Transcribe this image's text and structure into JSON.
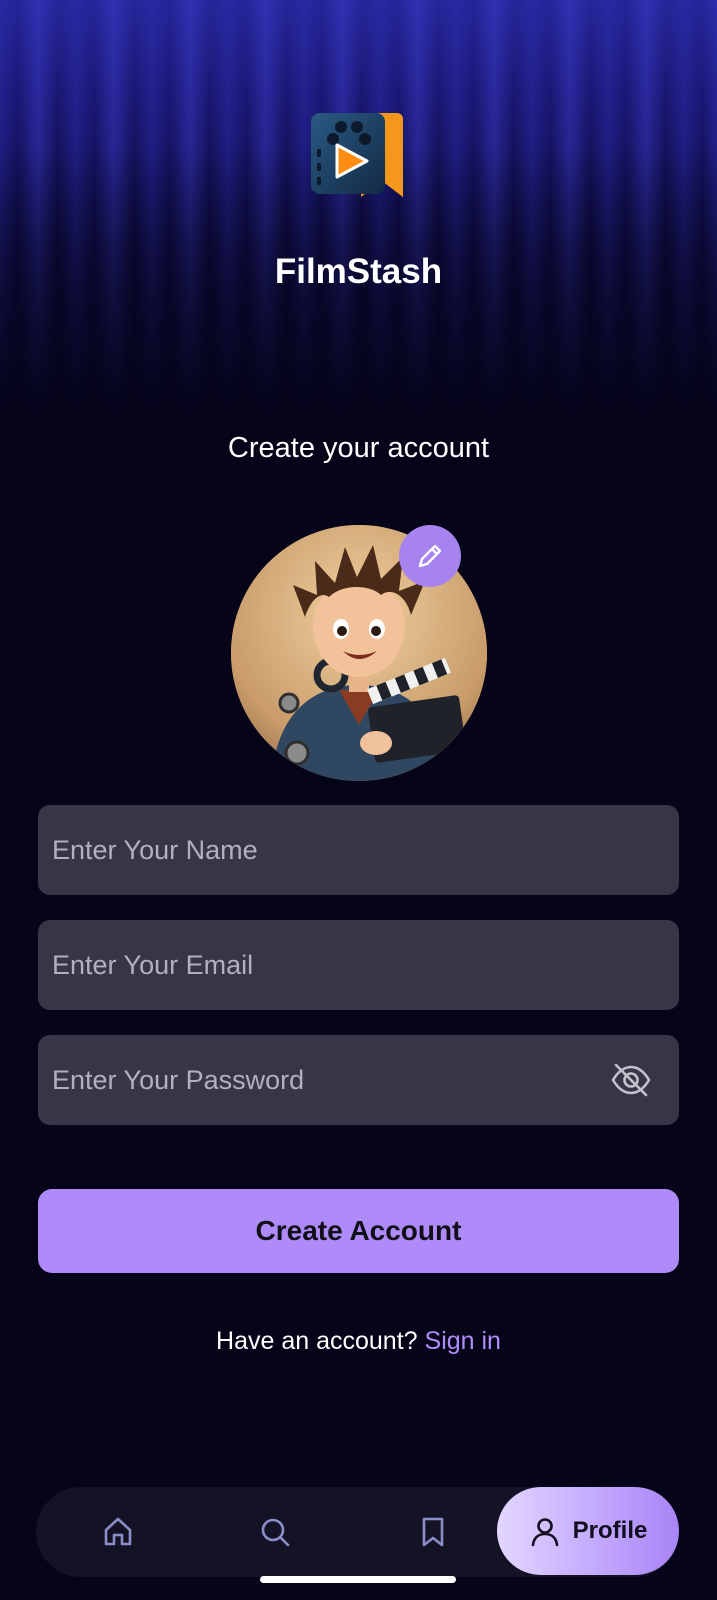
{
  "app": {
    "name": "FilmStash",
    "logo_icon": "film-play-bookmark-logo-icon"
  },
  "signup": {
    "heading": "Create your account",
    "avatar_icon": "cartoon-director-avatar",
    "edit_avatar_icon": "pencil-icon",
    "name_placeholder": "Enter Your Name",
    "email_placeholder": "Enter Your Email",
    "password_placeholder": "Enter Your Password",
    "password_toggle_icon": "eye-off-icon",
    "submit_label": "Create Account",
    "signin_prompt": "Have an account?",
    "signin_link": "Sign in"
  },
  "bottom_nav": {
    "items": [
      {
        "icon": "home-icon",
        "label": ""
      },
      {
        "icon": "search-icon",
        "label": ""
      },
      {
        "icon": "bookmark-icon",
        "label": ""
      },
      {
        "icon": "user-icon",
        "label": "Profile",
        "active": true
      }
    ]
  },
  "colors": {
    "background": "#050419",
    "field": "#383547",
    "accent": "#ae8bf8",
    "link": "#b18cfa"
  }
}
